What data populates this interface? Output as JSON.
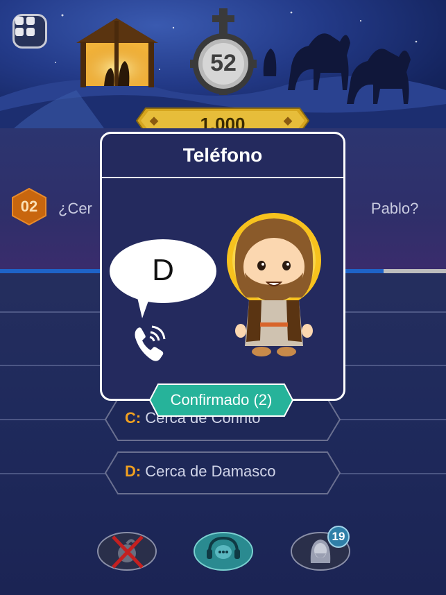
{
  "timer": {
    "value": "52"
  },
  "prize": {
    "amount": "1.000"
  },
  "question": {
    "number": "02",
    "text_left": "¿Cer",
    "text_right": "Pablo?"
  },
  "answers": [
    {
      "letter": "C:",
      "text": "Cerca de Corinto"
    },
    {
      "letter": "D:",
      "text": "Cerca de Damasco"
    }
  ],
  "dialog": {
    "title": "Teléfono",
    "bubble_answer": "D",
    "confirm_label": "Confirmado (2)"
  },
  "lifelines": {
    "fifty_fifty_icon": "cancelled-5050-icon",
    "audience_icon": "chat-headset-icon",
    "jesus_icon": "jesus-face-icon",
    "jesus_count": "19"
  },
  "colors": {
    "accent_orange": "#f0a020",
    "confirm_green": "#26b39a",
    "progress_blue": "#1e63c8",
    "badge_orange": "#c8660e"
  }
}
